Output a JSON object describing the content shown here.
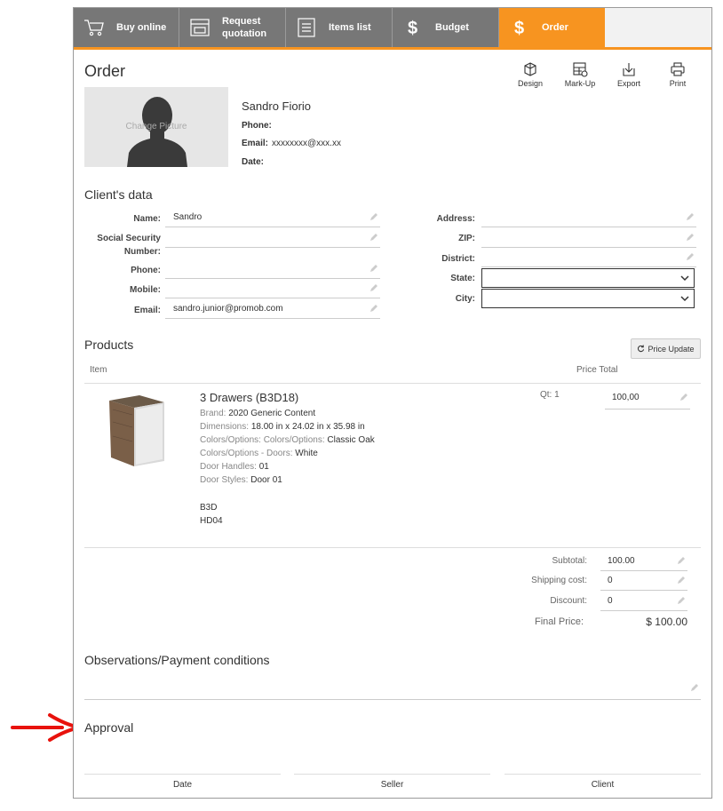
{
  "tabs": [
    {
      "label": "Buy online",
      "icon": "cart-icon"
    },
    {
      "label": "Request quotation",
      "icon": "store-icon"
    },
    {
      "label": "Items list",
      "icon": "list-icon"
    },
    {
      "label": "Budget",
      "icon": "dollar-icon"
    },
    {
      "label": "Order",
      "icon": "dollar-icon",
      "active": true
    }
  ],
  "page_title": "Order",
  "toolbar": {
    "design": "Design",
    "markup": "Mark-Up",
    "export": "Export",
    "print": "Print"
  },
  "client_card": {
    "change_picture": "Change Picture",
    "name": "Sandro Fiorio",
    "phone_label": "Phone:",
    "phone_value": "",
    "email_label": "Email:",
    "email_value": "xxxxxxxx@xxx.xx",
    "date_label": "Date:",
    "date_value": ""
  },
  "clients_data": {
    "heading": "Client's data",
    "name_label": "Name:",
    "name_value": "Sandro",
    "ssn_label_1": "Social Security",
    "ssn_label_2": "Number:",
    "ssn_value": "",
    "phone_label": "Phone:",
    "phone_value": "",
    "mobile_label": "Mobile:",
    "mobile_value": "",
    "email_label": "Email:",
    "email_value": "sandro.junior@promob.com",
    "address_label": "Address:",
    "address_value": "",
    "zip_label": "ZIP:",
    "zip_value": "",
    "district_label": "District:",
    "district_value": "",
    "state_label": "State:",
    "state_value": "",
    "city_label": "City:",
    "city_value": ""
  },
  "products": {
    "heading": "Products",
    "price_update": "Price Update",
    "col_item": "Item",
    "col_price_total": "Price Total",
    "item": {
      "name": "3 Drawers (B3D18)",
      "brand_label": "Brand:",
      "brand_value": "2020 Generic Content",
      "dim_label": "Dimensions:",
      "dim_value": "18.00 in x 24.02 in x 35.98 in",
      "colors_label": "Colors/Options: Colors/Options:",
      "colors_value": "Classic Oak",
      "doors_label": "Colors/Options - Doors:",
      "doors_value": "White",
      "handles_label": "Door Handles:",
      "handles_value": "01",
      "styles_label": "Door Styles:",
      "styles_value": "Door 01",
      "code1": "B3D",
      "code2": "HD04",
      "qty": "Qt: 1",
      "price": "100,00"
    }
  },
  "totals": {
    "subtotal_label": "Subtotal:",
    "subtotal_value": "100.00",
    "shipping_label": "Shipping cost:",
    "shipping_value": "0",
    "discount_label": "Discount:",
    "discount_value": "0",
    "final_label": "Final Price:",
    "final_value": "$ 100.00"
  },
  "observations": {
    "heading": "Observations/Payment conditions",
    "value": ""
  },
  "approval": {
    "heading": "Approval",
    "date": "Date",
    "seller": "Seller",
    "client": "Client"
  },
  "colors": {
    "accent": "#f79420",
    "tab_bg": "#777777",
    "arrow": "#e8120c"
  }
}
